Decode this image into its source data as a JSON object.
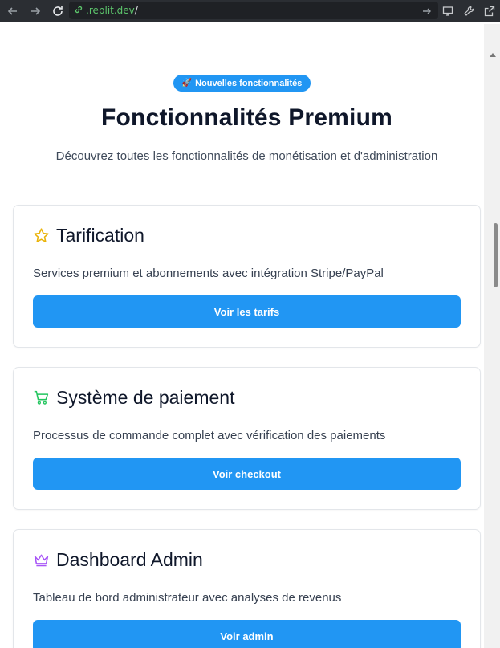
{
  "browser": {
    "url_host": ".replit.dev",
    "url_path": "/"
  },
  "hero": {
    "badge_emoji": "🚀",
    "badge_label": "Nouvelles fonctionnalités",
    "title": "Fonctionnalités Premium",
    "subtitle": "Découvrez toutes les fonctionnalités de monétisation et d'administration"
  },
  "cards": [
    {
      "icon": "star-icon",
      "icon_color": "#eab308",
      "title": "Tarification",
      "description": "Services premium et abonnements avec intégration Stripe/PayPal",
      "button_label": "Voir les tarifs"
    },
    {
      "icon": "shopping-cart-icon",
      "icon_color": "#22c55e",
      "title": "Système de paiement",
      "description": "Processus de commande complet avec vérification des paiements",
      "button_label": "Voir checkout"
    },
    {
      "icon": "crown-icon",
      "icon_color": "#a855f7",
      "title": "Dashboard Admin",
      "description": "Tableau de bord administrateur avec analyses de revenus",
      "button_label": "Voir admin"
    }
  ],
  "colors": {
    "accent": "#2196f3",
    "heading": "#0f172a"
  }
}
